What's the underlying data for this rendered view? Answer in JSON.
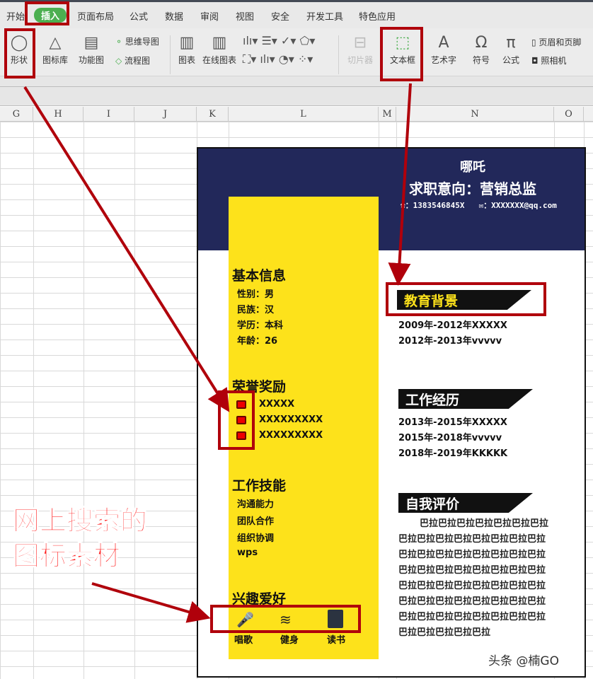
{
  "menu_tabs": [
    "开始",
    "插入",
    "页面布局",
    "公式",
    "数据",
    "审阅",
    "视图",
    "安全",
    "开发工具",
    "特色应用"
  ],
  "active_tab": "插入",
  "ribbon": {
    "shape": "形状",
    "icon_lib": "图标库",
    "func_chart": "功能图",
    "mindmap": "思维导图",
    "flowchart": "流程图",
    "chart": "图表",
    "online_chart": "在线图表",
    "slicer": "切片器",
    "textbox": "文本框",
    "wordart": "艺术字",
    "symbol": "符号",
    "formula": "公式",
    "header_footer": "页眉和页脚",
    "camera": "照相机"
  },
  "columns": [
    "G",
    "H",
    "I",
    "J",
    "K",
    "L",
    "M",
    "N",
    "O"
  ],
  "resume": {
    "name": "哪吒",
    "objective": "求职意向：营销总监",
    "phone": "：1383546845X",
    "email": "：XXXXXXX@qq.com",
    "basic": {
      "title": "基本信息",
      "items": [
        "性别：男",
        "民族：汉",
        "学历：本科",
        "年龄：26"
      ]
    },
    "honors": {
      "title": "荣誉奖励",
      "items": [
        "XXXXX",
        "XXXXXXXXX",
        "XXXXXXXXX"
      ]
    },
    "skills": {
      "title": "工作技能",
      "items": [
        "沟通能力",
        "团队合作",
        "组织协调",
        "wps"
      ]
    },
    "hobbies": {
      "title": "兴趣爱好",
      "items": [
        "唱歌",
        "健身",
        "读书"
      ]
    },
    "education": {
      "title": "教育背景",
      "items": [
        "2009年-2012年XXXXX",
        "2012年-2013年vvvvv"
      ]
    },
    "work": {
      "title": "工作经历",
      "items": [
        "2013年-2015年XXXXX",
        "2015年-2018年vvvvv",
        "2018年-2019年KKKKK"
      ]
    },
    "self": {
      "title": "自我评价",
      "text": "巴拉巴拉巴拉巴拉巴拉巴拉巴拉巴拉巴拉巴拉巴拉巴拉巴拉巴拉巴拉巴拉巴拉巴拉巴拉巴拉巴拉巴拉巴拉巴拉巴拉巴拉巴拉巴拉巴拉巴拉巴拉巴拉巴拉巴拉巴拉巴拉巴拉巴拉巴拉巴拉巴拉巴拉巴拉巴拉巴拉巴拉巴拉巴拉巴拉巴拉巴拉巴拉巴拉巴拉巴拉巴拉巴拉巴拉巴拉巴拉"
    }
  },
  "callout": {
    "line1": "网上搜索的",
    "line2": "图标素材"
  },
  "watermark": "头条 @楠GO",
  "colors": {
    "header": "#22285a",
    "sidebar": "#fde21b",
    "annotation": "#b0000b",
    "active_tab": "#4caf50"
  }
}
